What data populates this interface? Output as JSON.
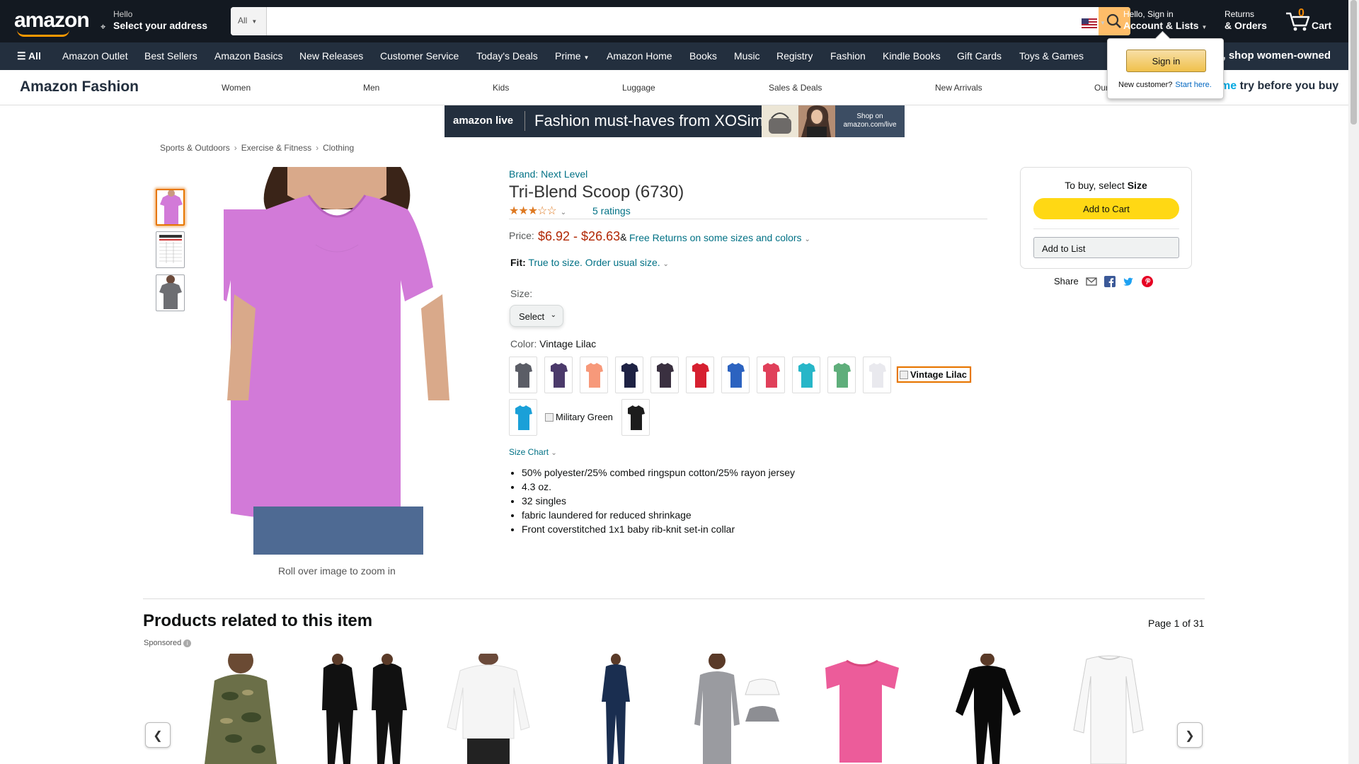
{
  "header": {
    "logo": "amazon",
    "deliver_line1": "Hello",
    "deliver_line2": "Select your address",
    "search_category": "All",
    "search_placeholder": "",
    "account_line1": "Hello, Sign in",
    "account_line2": "Account & Lists",
    "returns_line1": "Returns",
    "returns_line2": "& Orders",
    "cart_count": "0",
    "cart_label": "Cart"
  },
  "subnav": {
    "all": "All",
    "items": [
      "Amazon Outlet",
      "Best Sellers",
      "Amazon Basics",
      "New Releases",
      "Customer Service",
      "Today's Deals",
      "Prime",
      "Amazon Home",
      "Books",
      "Music",
      "Registry",
      "Fashion",
      "Kindle Books",
      "Gift Cards",
      "Toys & Games"
    ],
    "promo": "all, shop women-owned"
  },
  "fashion_bar": {
    "brand": "Amazon Fashion",
    "items": [
      "Women",
      "Men",
      "Kids",
      "Luggage",
      "Sales & Deals",
      "New Arrivals",
      "Our"
    ],
    "try_prime": "me",
    "try_text": "try before you buy"
  },
  "flyout": {
    "signin": "Sign in",
    "new_customer": "New customer?",
    "start_here": "Start here."
  },
  "banner": {
    "brand": "amazon live",
    "text": "Fashion must-haves from XOSimplyLo",
    "cta": "Shop on amazon.com/live"
  },
  "breadcrumb": [
    "Sports & Outdoors",
    "Exercise & Fitness",
    "Clothing"
  ],
  "gallery": {
    "zoom_hint": "Roll over image to zoom in"
  },
  "product": {
    "brand": "Brand: Next Level",
    "title": "Tri-Blend Scoop (6730)",
    "rating": 3,
    "ratings_text": "5 ratings",
    "price_label": "Price:",
    "price_low": "$6.92",
    "price_dash": " - ",
    "price_high": "$26.63",
    "price_amp": "&",
    "free_returns": "Free Returns on some sizes and colors",
    "fit_label": "Fit:",
    "fit_value": "True to size. Order usual size.",
    "size_label": "Size:",
    "size_value": "Select",
    "color_label": "Color:",
    "color_value": "Vintage Lilac",
    "swatch_colors": [
      "#5b5d66",
      "#4b3a6b",
      "#f7997a",
      "#1e2244",
      "#3a3040",
      "#d62030",
      "#2c63c0",
      "#e0405a",
      "#27b6c8",
      "#5fae7b",
      "#e9e9ee"
    ],
    "swatch_colors_row2": [
      "#1aa0d8",
      "#1c1c1c"
    ],
    "broken_swatch_selected": "Vintage Lilac",
    "broken_swatch_other": "Military Green",
    "size_chart": "Size Chart",
    "bullets": [
      "50% polyester/25% combed ringspun cotton/25% rayon jersey",
      "4.3 oz.",
      "32 singles",
      "fabric laundered for reduced shrinkage",
      "Front coverstitched 1x1 baby rib-knit set-in collar"
    ]
  },
  "buybox": {
    "hint_prefix": "To buy, select ",
    "hint_bold": "Size",
    "add_to_cart": "Add to Cart",
    "add_to_list": "Add to List",
    "share": "Share"
  },
  "related": {
    "title": "Products related to this item",
    "page": "Page 1 of 31",
    "sponsored": "Sponsored"
  },
  "colors": {
    "nav_dark": "#131921",
    "nav_sub": "#232f3e",
    "link": "#007185",
    "price": "#b12704",
    "cart_button": "#ffd814",
    "search_button": "#febd69",
    "selected_border": "#e77600",
    "product_shirt": "#d27ad8"
  }
}
